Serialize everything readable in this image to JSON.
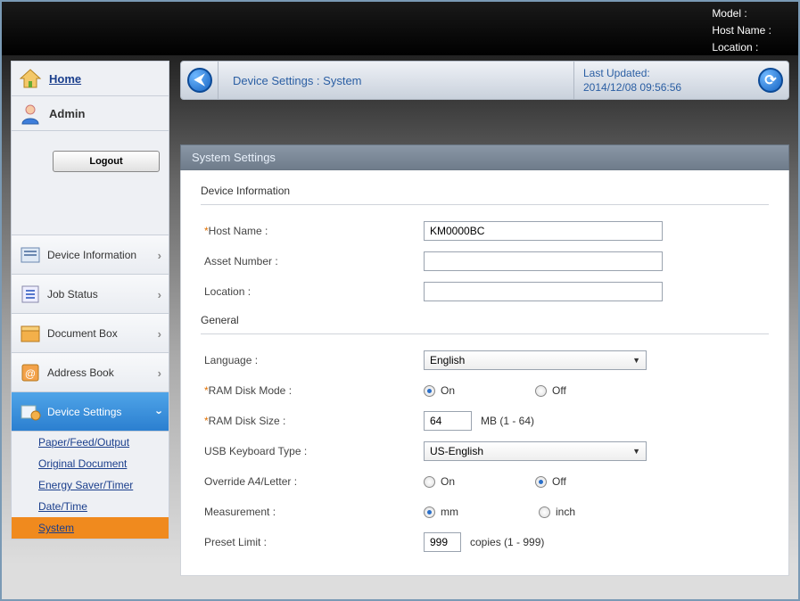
{
  "header": {
    "model_label": "Model :",
    "hostname_label": "Host Name :",
    "location_label": "Location :"
  },
  "sidebar": {
    "home": "Home",
    "admin": "Admin",
    "logout": "Logout",
    "nav": [
      {
        "label": "Device Information"
      },
      {
        "label": "Job Status"
      },
      {
        "label": "Document Box"
      },
      {
        "label": "Address Book"
      },
      {
        "label": "Device Settings"
      }
    ],
    "sub": [
      {
        "label": "Paper/Feed/Output"
      },
      {
        "label": "Original Document"
      },
      {
        "label": "Energy Saver/Timer"
      },
      {
        "label": "Date/Time"
      },
      {
        "label": "System"
      }
    ]
  },
  "breadcrumb": {
    "text": "Device Settings : System",
    "updated_label": "Last Updated:",
    "updated_value": "2014/12/08 09:56:56"
  },
  "panel": {
    "title": "System Settings",
    "sec_device": "Device Information",
    "sec_general": "General",
    "host_name_label": "Host Name :",
    "host_name_value": "KM0000BC",
    "asset_label": "Asset Number :",
    "asset_value": "",
    "location_label": "Location :",
    "location_value": "",
    "language_label": "Language :",
    "language_value": "English",
    "ram_mode_label": "RAM Disk Mode :",
    "ram_size_label": "RAM Disk Size :",
    "ram_size_value": "64",
    "ram_size_hint": "MB (1 - 64)",
    "usb_kb_label": "USB Keyboard Type :",
    "usb_kb_value": "US-English",
    "override_label": "Override A4/Letter :",
    "measurement_label": "Measurement :",
    "preset_label": "Preset Limit :",
    "preset_value": "999",
    "preset_hint": "copies (1 - 999)",
    "opts": {
      "on": "On",
      "off": "Off",
      "mm": "mm",
      "inch": "inch"
    }
  }
}
